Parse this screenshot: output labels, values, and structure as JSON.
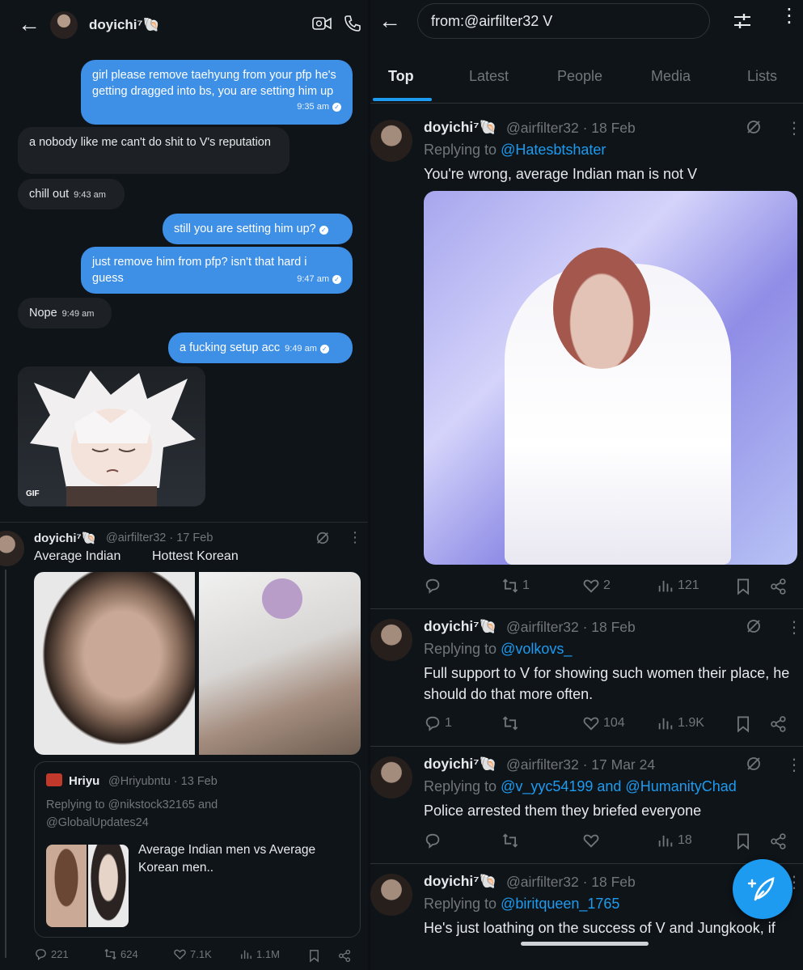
{
  "chat": {
    "header": {
      "name": "doyichi⁷🐚"
    },
    "messages": [
      {
        "dir": "out",
        "text": "girl please remove taehyung from your pfp he's getting dragged into bs, you are setting him up",
        "time": "9:35 am"
      },
      {
        "dir": "in",
        "text": "a nobody like me can't do shit to V's reputation",
        "time": ""
      },
      {
        "dir": "in",
        "text": "chill out",
        "time": "9:43 am"
      },
      {
        "dir": "out",
        "text": "still you are setting him up?",
        "time": ""
      },
      {
        "dir": "out",
        "text": "just remove him from pfp? isn't that hard i guess",
        "time": "9:47 am"
      },
      {
        "dir": "in",
        "text": "Nope",
        "time": "9:49 am"
      },
      {
        "dir": "out",
        "text": "a fucking setup acc",
        "time": "9:49 am"
      }
    ],
    "gif_label": "GIF"
  },
  "left_tweet": {
    "name": "doyichi⁷🐚",
    "handle": "@airfilter32 · 17 Feb",
    "caption_left": "Average Indian",
    "caption_right": "Hottest Korean",
    "quote": {
      "name": "Hriyu",
      "handle": "@Hriyubntu · 13 Feb",
      "reply": "Replying to @nikstock32165 and @GlobalUpdates24",
      "text": "Average Indian men vs Average Korean men.."
    },
    "actions": {
      "replies": "221",
      "reposts": "624",
      "likes": "7.1K",
      "views": "1.1M"
    }
  },
  "search": {
    "query": "from:@airfilter32 V",
    "tabs": [
      "Top",
      "Latest",
      "People",
      "Media",
      "Lists"
    ],
    "active_tab": "Top"
  },
  "results": [
    {
      "name": "doyichi⁷🐚",
      "handle": "@airfilter32 · 18 Feb",
      "reply_prefix": "Replying to ",
      "reply_to": "@Hatesbtshater",
      "text": "You're wrong, average Indian man is not V",
      "actions": {
        "replies": "",
        "reposts": "1",
        "likes": "2",
        "views": "121"
      }
    },
    {
      "name": "doyichi⁷🐚",
      "handle": "@airfilter32 · 18 Feb",
      "reply_prefix": "Replying to ",
      "reply_to": "@volkovs_",
      "text": "Full support to V for showing such women their place, he should do that more often.",
      "actions": {
        "replies": "1",
        "reposts": "",
        "likes": "104",
        "views": "1.9K"
      }
    },
    {
      "name": "doyichi⁷🐚",
      "handle": "@airfilter32 · 17 Mar 24",
      "reply_prefix": "Replying to ",
      "reply_to": "@v_yyc54199 and @HumanityChad",
      "text": "Police arrested them they briefed everyone",
      "actions": {
        "replies": "",
        "reposts": "",
        "likes": "",
        "views": "18"
      }
    },
    {
      "name": "doyichi⁷🐚",
      "handle": "@airfilter32 · 18 Feb",
      "reply_prefix": "Replying to ",
      "reply_to": "@biritqueen_1765",
      "text": "He's just loathing on the success of V and Jungkook, if",
      "actions": {
        "replies": "",
        "reposts": "",
        "likes": "",
        "views": ""
      }
    }
  ],
  "icons": {
    "back": "arrow-left-icon",
    "video": "video-call-icon",
    "phone": "phone-icon",
    "filter": "filter-sliders-icon",
    "more": "more-vertical-icon",
    "grok": "grok-icon",
    "reply": "reply-icon",
    "repost": "repost-icon",
    "like": "heart-icon",
    "views": "views-chart-icon",
    "bookmark": "bookmark-icon",
    "share": "share-icon",
    "compose": "compose-feather-icon"
  },
  "colors": {
    "accent": "#1d9bf0",
    "bubble_out": "#3e8fe6",
    "background": "#0f1419"
  }
}
